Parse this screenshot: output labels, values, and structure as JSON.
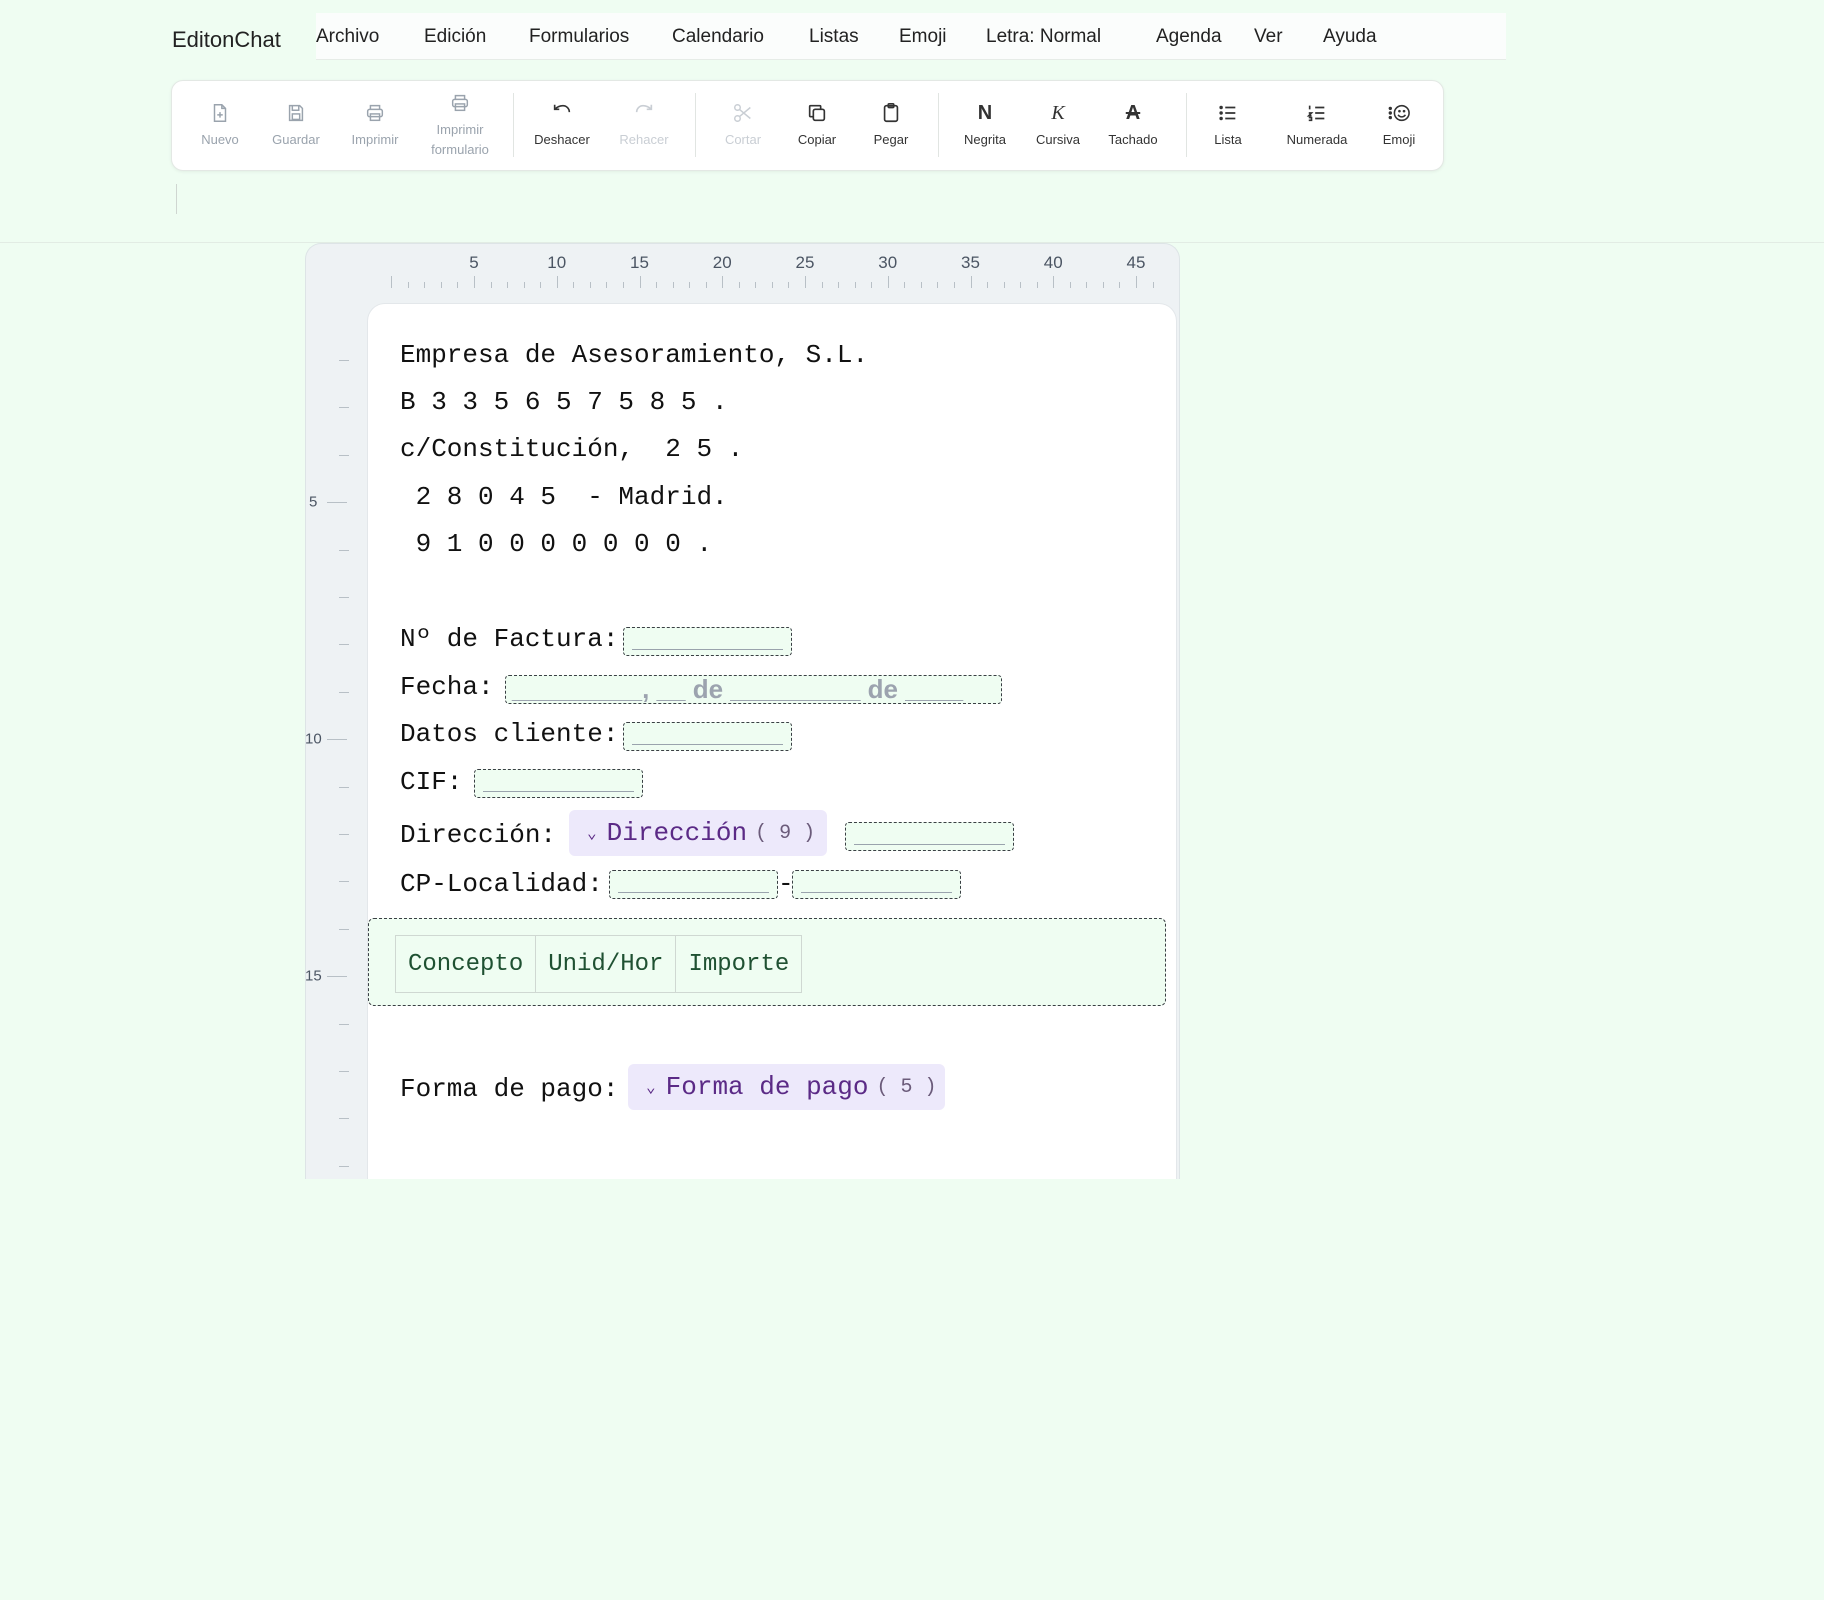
{
  "app": {
    "title": "EditonChat"
  },
  "menu": [
    "Archivo",
    "Edición",
    "Formularios",
    "Calendario",
    "Listas",
    "Emoji",
    "Letra: Normal",
    "Agenda",
    "Ver",
    "Ayuda"
  ],
  "toolbar": {
    "nuevo": "Nuevo",
    "guardar": "Guardar",
    "imprimir": "Imprimir",
    "imprimir_formulario_1": "Imprimir",
    "imprimir_formulario_2": "formulario",
    "deshacer": "Deshacer",
    "rehacer": "Rehacer",
    "cortar": "Cortar",
    "copiar": "Copiar",
    "pegar": "Pegar",
    "negrita_glyph": "N",
    "negrita": "Negrita",
    "cursiva_glyph": "K",
    "cursiva": "Cursiva",
    "tachado_glyph": "A",
    "tachado": "Tachado",
    "lista": "Lista",
    "numerada": "Numerada",
    "emoji": "Emoji"
  },
  "ruler": {
    "horizontal": [
      "5",
      "10",
      "15",
      "20",
      "25",
      "30",
      "35",
      "40",
      "45"
    ],
    "vertical": [
      "5",
      "10",
      "15"
    ]
  },
  "document": {
    "company": "Empresa de Asesoramiento, S.L.",
    "cif_company": "B 3 3 5 6 5 7 5 8 5 .",
    "street": "c/Constitución,  2 5 .",
    "city": " 2 8 0 4 5  - Madrid.",
    "phone": " 9 1 0 0 0 0 0 0 0 .",
    "invoice_label": "Nº de Factura:",
    "date_label": "Fecha:",
    "date_placeholder": "_________, __ de _________ de ____",
    "client_label": "Datos cliente:",
    "cif_label": "CIF:",
    "address_label": "Dirección:",
    "address_dropdown": "Dirección",
    "address_count": "( 9 )",
    "cp_label": "CP-Localidad:",
    "cp_separator": "-",
    "table_headers": [
      "Concepto",
      "Unid/Hor",
      "Importe"
    ],
    "payment_label": "Forma de pago:",
    "payment_dropdown": "Forma de pago",
    "payment_count": "( 5 )"
  }
}
